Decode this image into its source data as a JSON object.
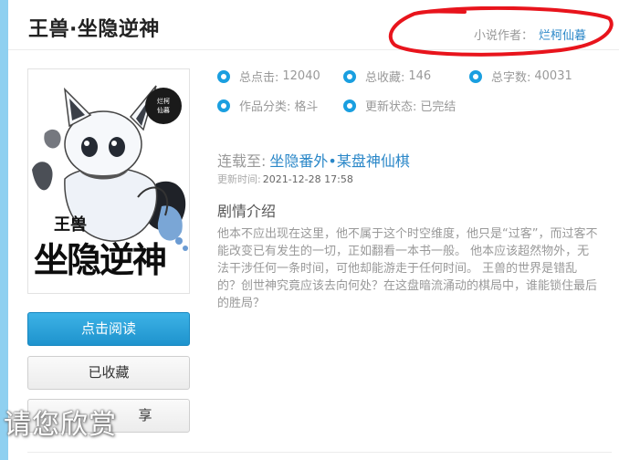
{
  "book": {
    "title": "王兽·坐隐逆神",
    "author_label": "小说作者：",
    "author_name": "烂柯仙暮"
  },
  "cover": {
    "title_small": "王兽",
    "title_big": "坐隐逆神",
    "seal_text": "烂柯仙暮",
    "art": "white fox-like creature"
  },
  "stats": [
    {
      "label": "总点击:",
      "value": "12040"
    },
    {
      "label": "总收藏:",
      "value": "146"
    },
    {
      "label": "总字数:",
      "value": "40031"
    },
    {
      "label": "作品分类:",
      "value": "格斗"
    },
    {
      "label": "更新状态:",
      "value": "已完结"
    }
  ],
  "latest": {
    "label": "连载至:",
    "chapter": "坐隐番外•某盘神仙棋",
    "time_label": "更新时间:",
    "time": "2021-12-28 17:58"
  },
  "synopsis": {
    "heading": "剧情介绍",
    "text": "他本不应出现在这里，他不属于这个时空维度，他只是“过客”，而过客不能改变已有发生的一切，正如翻看一本书一般。 他本应该超然物外，无法干涉任何一条时间，可他却能游走于任何时间。 王兽的世界是错乱的？创世神究竟应该去向何处？在这盘暗流涌动的棋局中，谁能锁住最后的胜局？"
  },
  "buttons": {
    "read": "点击阅读",
    "favorited": "已收藏",
    "share": "享"
  },
  "watermark": "请您欣赏",
  "colors": {
    "accent": "#1a9fe0",
    "link": "#2a87c8",
    "annotation": "#e8141c"
  }
}
